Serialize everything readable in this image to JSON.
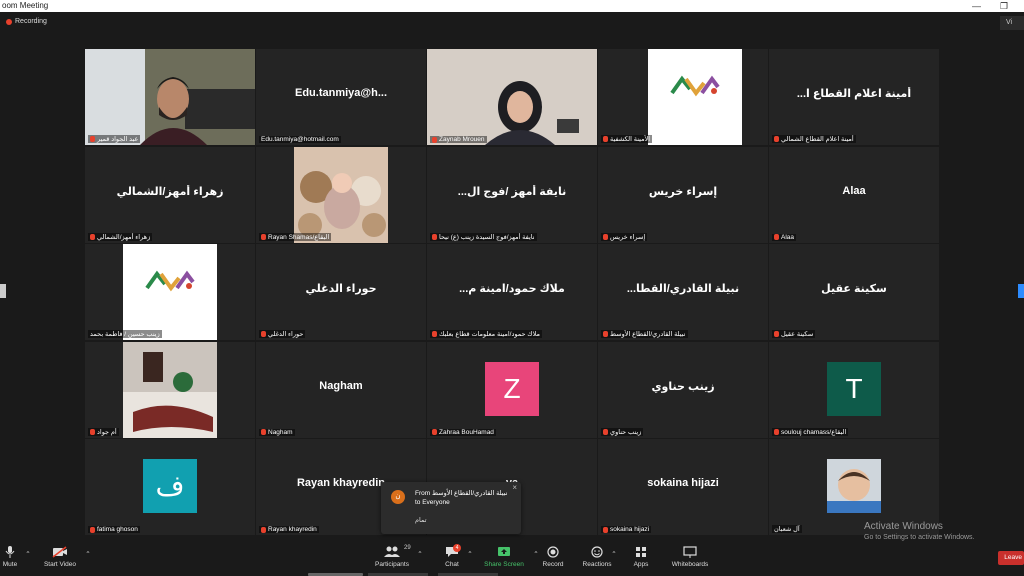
{
  "window": {
    "title": "oom Meeting",
    "controls": [
      "—",
      "❐"
    ]
  },
  "topbar": {
    "recording_label": "Recording",
    "view_label": "Vi"
  },
  "tiles": [
    {
      "id": "t1",
      "big": "",
      "label": "عبد الجواد قمير",
      "kind": "video-man",
      "muted": true,
      "active": true
    },
    {
      "id": "t2",
      "big": "Edu.tanmiya@h...",
      "label": "Edu.tanmiya@hotmail.com",
      "kind": "name",
      "muted": false
    },
    {
      "id": "t3",
      "big": "",
      "label": "Zaynab Mrouen",
      "kind": "video-woman",
      "muted": true
    },
    {
      "id": "t4",
      "big": "",
      "label": "الأمينة الكشفية",
      "kind": "logo",
      "muted": true
    },
    {
      "id": "t5",
      "big": "...أمينة اعلام القطاع ا",
      "label": "أمينة اعلام القطاع الشمالي",
      "kind": "name",
      "muted": true
    },
    {
      "id": "t6",
      "big": "زهراء أمهز/الشمالي",
      "label": "زهراء أمهز/الشمالي",
      "kind": "name",
      "muted": true
    },
    {
      "id": "t7",
      "big": "",
      "label": "Rayan Shamas/البقاع",
      "kind": "baby",
      "muted": true
    },
    {
      "id": "t8",
      "big": "...نايفة أمهز /فوج ال",
      "label": "نايفة أمهز/فوج السيدة زينب (ع) نيحا",
      "kind": "name",
      "muted": true
    },
    {
      "id": "t9",
      "big": "إسراء خريس",
      "label": "إسراء خريس",
      "kind": "name",
      "muted": true
    },
    {
      "id": "t10",
      "big": "Alaa",
      "label": "Alaa",
      "kind": "name",
      "muted": true
    },
    {
      "id": "t11",
      "big": "",
      "label": "زينب حسين / فاطمة بحمد",
      "kind": "logo2",
      "muted": false
    },
    {
      "id": "t12",
      "big": "حوراء الدغلي",
      "label": "حوراء الدغلي",
      "kind": "name",
      "muted": true
    },
    {
      "id": "t13",
      "big": "...ملاك حمود/امينة م",
      "label": "ملاك حمود/امينة معلومات قطاع بعلبك",
      "kind": "name",
      "muted": true
    },
    {
      "id": "t14",
      "big": "...نبيلة القادري/القطا",
      "label": "نبيلة القادري/القطاع الأوسط",
      "kind": "name",
      "muted": true
    },
    {
      "id": "t15",
      "big": "سكينة عقيل",
      "label": "سكينة عقيل",
      "kind": "name",
      "muted": true
    },
    {
      "id": "t16",
      "big": "",
      "label": "أم جواد",
      "kind": "photo",
      "muted": true
    },
    {
      "id": "t17",
      "big": "Nagham",
      "label": "Nagham",
      "kind": "name",
      "muted": true
    },
    {
      "id": "t18",
      "big": "",
      "label": "Zahraa BouHamad",
      "kind": "letter",
      "letter": "Z",
      "color": "#e8457a",
      "muted": true
    },
    {
      "id": "t19",
      "big": "زينب حناوي",
      "label": "زينب حناوي",
      "kind": "name",
      "muted": true
    },
    {
      "id": "t20",
      "big": "",
      "label": "soulouj chamass/البقاع",
      "kind": "letter",
      "letter": "T",
      "color": "#0e5b4a",
      "muted": true
    },
    {
      "id": "t21",
      "big": "",
      "label": "fatima ghoson",
      "kind": "letter",
      "letter": "ف",
      "color": "#11a0b0",
      "muted": true
    },
    {
      "id": "t22",
      "big": "Rayan khayredin",
      "label": "Rayan khayredin",
      "kind": "name",
      "muted": true
    },
    {
      "id": "t23",
      "big": "ya",
      "label": "",
      "kind": "name",
      "muted": false
    },
    {
      "id": "t24",
      "big": "sokaina hijazi",
      "label": "sokaina hijazi",
      "kind": "name",
      "muted": true
    },
    {
      "id": "t25",
      "big": "",
      "label": "آل شعبان",
      "kind": "child",
      "muted": false
    }
  ],
  "chat_popup": {
    "avatar": "ن",
    "from": "From نبيلة القادري/القطاع الأوسط to Everyone",
    "message": "تمام",
    "close": "×"
  },
  "toolbar": {
    "mute": "Mute",
    "start_video": "Start Video",
    "participants": "Participants",
    "participants_count": "29",
    "chat": "Chat",
    "chat_badge": "4",
    "share_screen": "Share Screen",
    "record": "Record",
    "reactions": "Reactions",
    "apps": "Apps",
    "whiteboards": "Whiteboards",
    "leave": "Leave"
  },
  "watermark": {
    "line1": "Activate Windows",
    "line2": "Go to Settings to activate Windows."
  },
  "colors": {
    "recording": "#e8412c",
    "active_border": "#e3e83a",
    "share": "#46c36a",
    "leave": "#c9302c"
  }
}
